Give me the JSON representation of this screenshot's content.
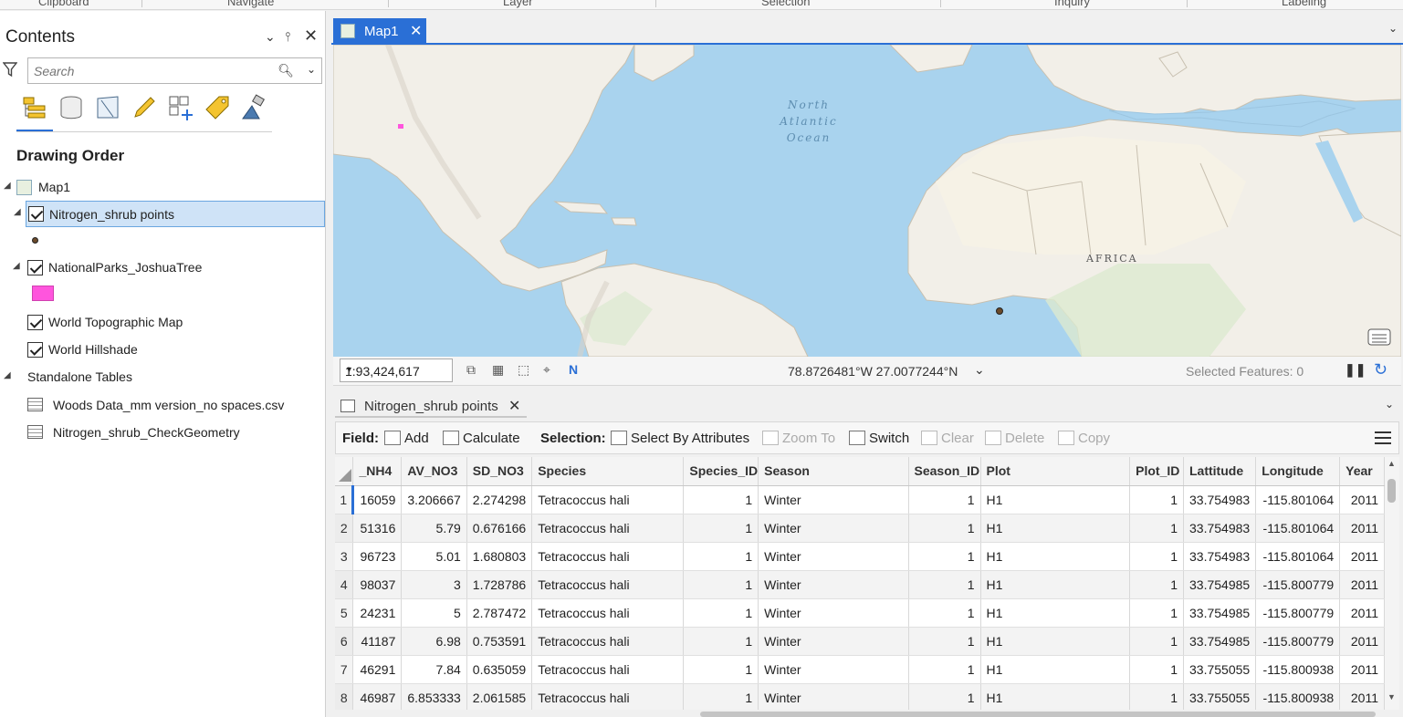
{
  "ribbon": {
    "groups": [
      "Clipboard",
      "Navigate",
      "Layer",
      "Selection",
      "Inquiry",
      "Labeling"
    ]
  },
  "contents": {
    "title": "Contents",
    "search_placeholder": "Search",
    "drawing_order": "Drawing Order",
    "map_name": "Map1",
    "layers": [
      {
        "label": "Nitrogen_shrub points",
        "checked": true
      },
      {
        "label": "NationalParks_JoshuaTree",
        "checked": true
      },
      {
        "label": "World Topographic Map",
        "checked": true
      },
      {
        "label": "World Hillshade",
        "checked": true
      }
    ],
    "standalone_tables_label": "Standalone Tables",
    "standalone_tables": [
      "Woods Data_mm version_no spaces.csv",
      "Nitrogen_shrub_CheckGeometry"
    ],
    "symbol_colors": {
      "points": "#6b4a2a",
      "parks": "#ff55dd"
    }
  },
  "map": {
    "tab_label": "Map1",
    "labels": {
      "ocean_line1": "North",
      "ocean_line2": "Atlantic",
      "ocean_line3": "Ocean",
      "continent": "AFRICA"
    },
    "scale": "1:93,424,617",
    "coordinates": "78.8726481°W 27.0077244°N",
    "selected_features": "Selected Features: 0"
  },
  "table": {
    "tab_label": "Nitrogen_shrub points",
    "toolbar": {
      "field_label": "Field:",
      "add": "Add",
      "calculate": "Calculate",
      "selection_label": "Selection:",
      "select_by_attributes": "Select By Attributes",
      "zoom_to": "Zoom To",
      "switch": "Switch",
      "clear": "Clear",
      "delete": "Delete",
      "copy": "Copy"
    },
    "columns": [
      "_NH4",
      "AV_NO3",
      "SD_NO3",
      "Species",
      "Species_ID",
      "Season",
      "Season_ID",
      "Plot",
      "Plot_ID",
      "Lattitude",
      "Longitude",
      "Year"
    ],
    "rows": [
      [
        "1",
        "16059",
        "3.206667",
        "2.274298",
        "Tetracoccus hali",
        "1",
        "Winter",
        "1",
        "H1",
        "1",
        "33.754983",
        "-115.801064",
        "2011"
      ],
      [
        "2",
        "51316",
        "5.79",
        "0.676166",
        "Tetracoccus hali",
        "1",
        "Winter",
        "1",
        "H1",
        "1",
        "33.754983",
        "-115.801064",
        "2011"
      ],
      [
        "3",
        "96723",
        "5.01",
        "1.680803",
        "Tetracoccus hali",
        "1",
        "Winter",
        "1",
        "H1",
        "1",
        "33.754983",
        "-115.801064",
        "2011"
      ],
      [
        "4",
        "98037",
        "3",
        "1.728786",
        "Tetracoccus hali",
        "1",
        "Winter",
        "1",
        "H1",
        "1",
        "33.754985",
        "-115.800779",
        "2011"
      ],
      [
        "5",
        "24231",
        "5",
        "2.787472",
        "Tetracoccus hali",
        "1",
        "Winter",
        "1",
        "H1",
        "1",
        "33.754985",
        "-115.800779",
        "2011"
      ],
      [
        "6",
        "41187",
        "6.98",
        "0.753591",
        "Tetracoccus hali",
        "1",
        "Winter",
        "1",
        "H1",
        "1",
        "33.754985",
        "-115.800779",
        "2011"
      ],
      [
        "7",
        "46291",
        "7.84",
        "0.635059",
        "Tetracoccus hali",
        "1",
        "Winter",
        "1",
        "H1",
        "1",
        "33.755055",
        "-115.800938",
        "2011"
      ],
      [
        "8",
        "46987",
        "6.853333",
        "2.061585",
        "Tetracoccus hali",
        "1",
        "Winter",
        "1",
        "H1",
        "1",
        "33.755055",
        "-115.800938",
        "2011"
      ]
    ]
  }
}
